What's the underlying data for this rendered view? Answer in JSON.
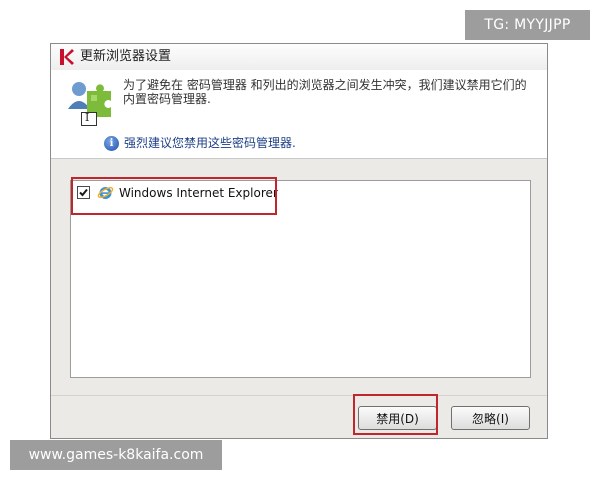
{
  "watermarks": {
    "top_right": "TG: MYYJJPP",
    "bottom_left": "www.games-k8kaifa.com"
  },
  "dialog": {
    "title": "更新浏览器设置",
    "description": "为了避免在 密码管理器 和列出的浏览器之间发生冲突，我们建议禁用它们的内置密码管理器.",
    "info": "强烈建议您禁用这些密码管理器.",
    "cursor_glyph": "I",
    "list": [
      {
        "label": "Windows Internet Explorer",
        "checked": true
      }
    ],
    "buttons": {
      "disable": "禁用(D)",
      "ignore": "忽略(I)"
    }
  },
  "colors": {
    "highlight": "#c0272d",
    "info_text": "#1d3f86",
    "dialog_bg": "#eceae6"
  },
  "icons": {
    "app": "kaspersky-k-icon",
    "header": "users-puzzle-icon",
    "info": "info-icon",
    "browser": "internet-explorer-icon",
    "check": "checkmark-icon"
  }
}
